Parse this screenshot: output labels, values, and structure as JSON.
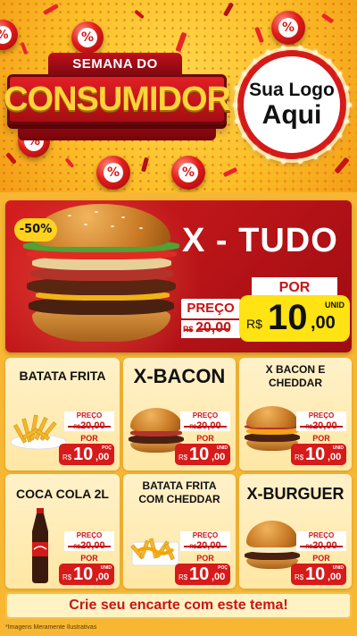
{
  "header": {
    "title_top": "SEMANA DO",
    "title_main": "CONSUMIDOR",
    "logo_line1": "Sua Logo",
    "logo_line2": "Aqui",
    "percent_symbol": "%"
  },
  "hero": {
    "discount": "-50%",
    "name": "X - TUDO",
    "preco_label": "PREÇO",
    "old_currency": "R$",
    "old_price": "20,00",
    "por_label": "POR",
    "currency": "R$",
    "price_int": "10",
    "price_dec": ",00",
    "unit": "UNID"
  },
  "products": [
    {
      "name": "BATATA FRITA",
      "preco_label": "PREÇO",
      "old_currency": "R$",
      "old_price": "20,00",
      "por_label": "POR",
      "currency": "R$",
      "price_int": "10",
      "price_dec": ",00",
      "unit": "POÇ"
    },
    {
      "name": "X-BACON",
      "preco_label": "PREÇO",
      "old_currency": "R$",
      "old_price": "20,00",
      "por_label": "POR",
      "currency": "R$",
      "price_int": "10",
      "price_dec": ",00",
      "unit": "UNID"
    },
    {
      "name": "X BACON E CHEDDAR",
      "preco_label": "PREÇO",
      "old_currency": "R$",
      "old_price": "20,00",
      "por_label": "POR",
      "currency": "R$",
      "price_int": "10",
      "price_dec": ",00",
      "unit": "UNID"
    },
    {
      "name": "COCA COLA 2L",
      "preco_label": "PREÇO",
      "old_currency": "R$",
      "old_price": "20,00",
      "por_label": "POR",
      "currency": "R$",
      "price_int": "10",
      "price_dec": ",00",
      "unit": "UNID"
    },
    {
      "name": "BATATA FRITA COM CHEDDAR",
      "preco_label": "PREÇO",
      "old_currency": "R$",
      "old_price": "20,00",
      "por_label": "POR",
      "currency": "R$",
      "price_int": "10",
      "price_dec": ",00",
      "unit": "POÇ"
    },
    {
      "name": "X-BURGUER",
      "preco_label": "PREÇO",
      "old_currency": "R$",
      "old_price": "20,00",
      "por_label": "POR",
      "currency": "R$",
      "price_int": "10",
      "price_dec": ",00",
      "unit": "UNID"
    }
  ],
  "footer": {
    "cta": "Crie seu encarte com este tema!",
    "disclaimer": "*Imagens Meramente Ilustrativas"
  },
  "colors": {
    "brand_red": "#d41d1f",
    "brand_yellow": "#ffd21f",
    "background": "#f7b733"
  }
}
